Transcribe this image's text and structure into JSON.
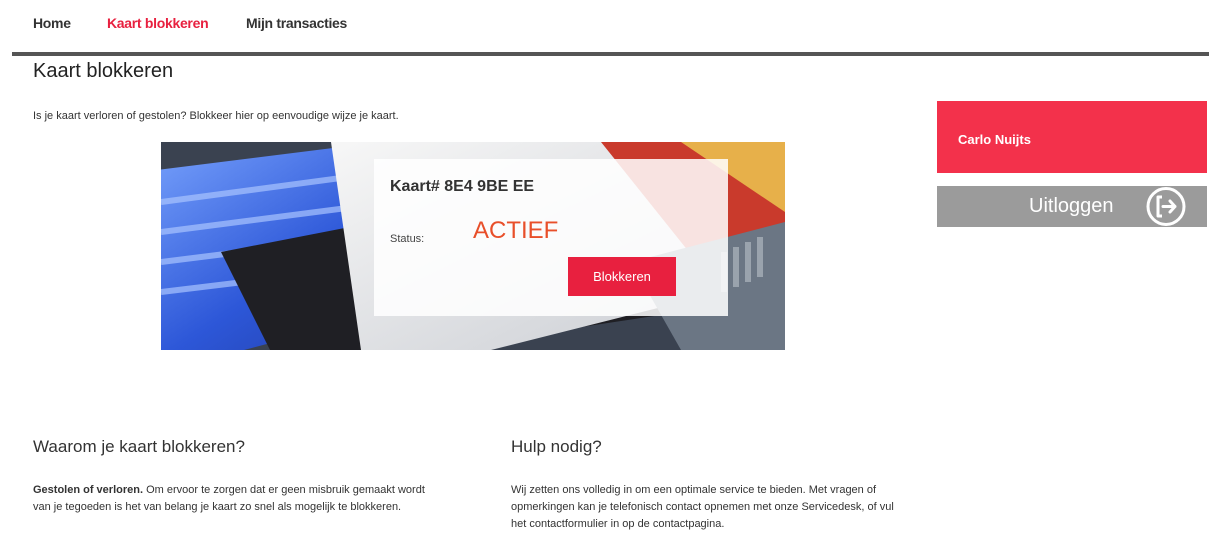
{
  "nav": {
    "items": [
      {
        "label": "Home"
      },
      {
        "label": "Kaart blokkeren"
      },
      {
        "label": "Mijn transacties"
      }
    ]
  },
  "page": {
    "title": "Kaart blokkeren",
    "intro": "Is je kaart verloren of gestolen? Blokkeer hier op eenvoudige wijze je kaart."
  },
  "card": {
    "number": "Kaart# 8E4 9BE EE",
    "status_label": "Status:",
    "status_value": "ACTIEF",
    "block_label": "Blokkeren"
  },
  "user": {
    "name": "Carlo Nuijts",
    "logout_label": "Uitloggen"
  },
  "sections": {
    "why": {
      "title": "Waarom je kaart blokkeren?",
      "lead": "Gestolen of verloren.",
      "body": " Om ervoor te zorgen dat er geen misbruik gemaakt wordt van je tegoeden is het van belang je kaart zo snel als mogelijk te blokkeren."
    },
    "help": {
      "title": "Hulp nodig?",
      "body": "Wij zetten ons volledig in om een optimale service te bieden. Met vragen of opmerkingen kan je telefonisch contact opnemen met onze Servicedesk, of vul het contactformulier in op de contactpagina."
    }
  },
  "colors": {
    "accent": "#e8203f",
    "status": "#e84f2a",
    "user_panel": "#f3314b",
    "logout": "#9b9b9b"
  }
}
